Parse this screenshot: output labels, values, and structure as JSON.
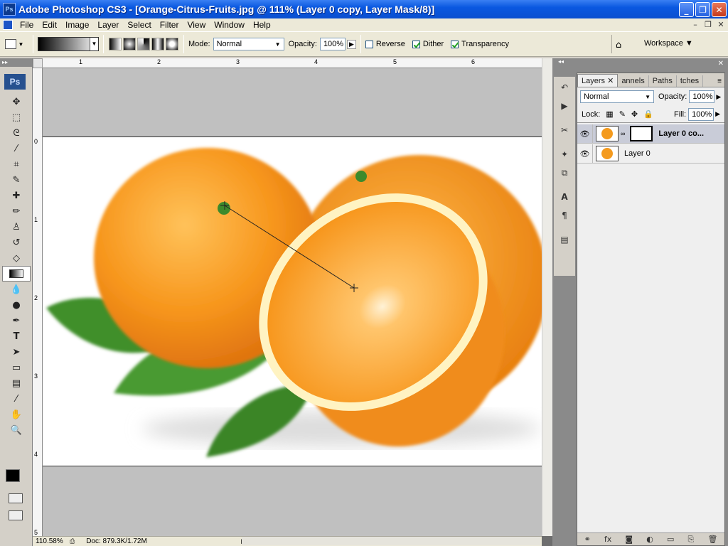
{
  "window": {
    "title": "Adobe Photoshop CS3 - [Orange-Citrus-Fruits.jpg @ 111% (Layer 0 copy, Layer Mask/8)]",
    "app_icon": "Ps"
  },
  "menu": [
    "File",
    "Edit",
    "Image",
    "Layer",
    "Select",
    "Filter",
    "View",
    "Window",
    "Help"
  ],
  "options": {
    "mode_label": "Mode:",
    "mode_value": "Normal",
    "opacity_label": "Opacity:",
    "opacity_value": "100%",
    "reverse_label": "Reverse",
    "reverse_checked": false,
    "dither_label": "Dither",
    "dither_checked": true,
    "transparency_label": "Transparency",
    "transparency_checked": true,
    "workspace_label": "Workspace"
  },
  "toolbox": {
    "logo": "Ps"
  },
  "ruler": {
    "top": [
      "1",
      "2",
      "3",
      "4",
      "5",
      "6"
    ],
    "left": [
      "0",
      "1",
      "2",
      "3",
      "4",
      "5"
    ]
  },
  "status": {
    "zoom": "110.58%",
    "doc": "Doc: 879.3K/1.72M"
  },
  "layers_panel": {
    "tabs": [
      "Layers",
      "annels",
      "Paths",
      "tches"
    ],
    "blend_mode": "Normal",
    "opacity_label": "Opacity:",
    "opacity_value": "100%",
    "lock_label": "Lock:",
    "fill_label": "Fill:",
    "fill_value": "100%",
    "layers": [
      {
        "name": "Layer 0 co...",
        "selected": true,
        "has_mask": true
      },
      {
        "name": "Layer 0",
        "selected": false,
        "has_mask": false
      }
    ]
  },
  "colors": {
    "title_blue": "#0a58e0",
    "menubar": "#ece9d8",
    "orange": "#f49a1e",
    "leaf": "#3f8f2a"
  }
}
